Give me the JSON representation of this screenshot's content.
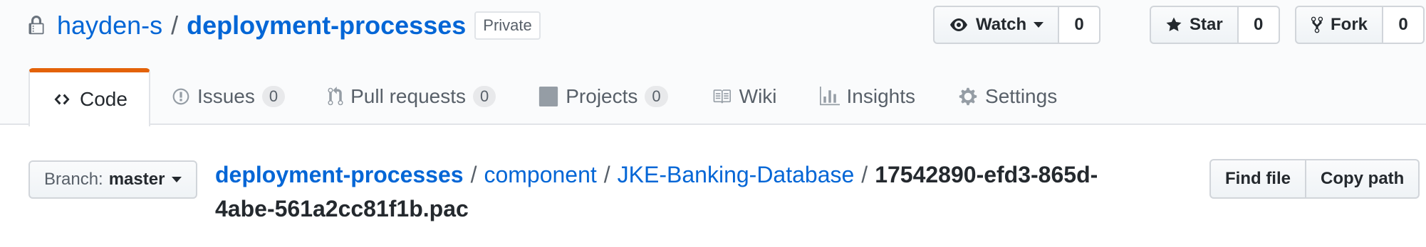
{
  "repo": {
    "owner": "hayden-s",
    "separator": "/",
    "name": "deployment-processes",
    "visibility": "Private"
  },
  "actions": {
    "watch": {
      "label": "Watch",
      "count": "0"
    },
    "star": {
      "label": "Star",
      "count": "0"
    },
    "fork": {
      "label": "Fork",
      "count": "0"
    }
  },
  "tabs": [
    {
      "label": "Code",
      "icon": "code-icon",
      "selected": true
    },
    {
      "label": "Issues",
      "icon": "issue-icon",
      "count": "0"
    },
    {
      "label": "Pull requests",
      "icon": "pull-request-icon",
      "count": "0"
    },
    {
      "label": "Projects",
      "icon": "project-icon",
      "count": "0"
    },
    {
      "label": "Wiki",
      "icon": "book-icon"
    },
    {
      "label": "Insights",
      "icon": "graph-icon"
    },
    {
      "label": "Settings",
      "icon": "gear-icon"
    }
  ],
  "branch": {
    "prefix": "Branch:",
    "name": "master"
  },
  "breadcrumb": {
    "root": "deployment-processes",
    "sep": "/",
    "path": [
      "component",
      "JKE-Banking-Database"
    ],
    "file": "17542890-efd3-865d-4abe-561a2cc81f1b.pac"
  },
  "file_actions": {
    "find_file": "Find file",
    "copy_path": "Copy path"
  },
  "colors": {
    "link": "#0366d6",
    "selected_tab_accent": "#e36209"
  }
}
